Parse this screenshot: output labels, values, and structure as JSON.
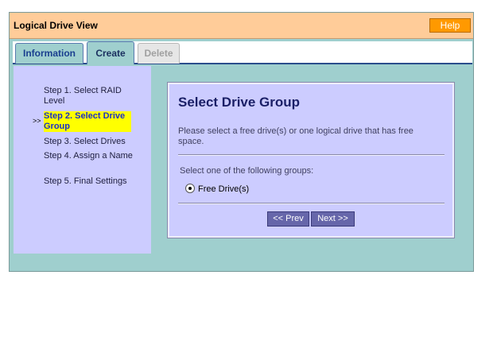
{
  "window": {
    "title": "Logical Drive View",
    "help_label": "Help"
  },
  "tabs": [
    {
      "label": "Information"
    },
    {
      "label": "Create"
    },
    {
      "label": "Delete"
    }
  ],
  "sidebar": {
    "current_marker": ">>",
    "steps": [
      {
        "label": "Step 1. Select RAID Level"
      },
      {
        "label": "Step 2. Select Drive Group"
      },
      {
        "label": "Step 3. Select Drives"
      },
      {
        "label": "Step 4. Assign a Name"
      },
      {
        "label": "Step 5. Final Settings"
      }
    ]
  },
  "panel": {
    "heading": "Select Drive Group",
    "description": "Please select a free drive(s) or one logical drive that has free space.",
    "prompt": "Select one of the following groups:",
    "option_label": "Free Drive(s)",
    "prev_label": "<< Prev",
    "next_label": "Next >>"
  },
  "colors": {
    "titlebar": "#ffcc99",
    "help_button": "#ff9900",
    "frame": "#9fcfce",
    "panel": "#ccccff",
    "current_step_highlight": "#ffff00",
    "nav_button": "#6666aa"
  }
}
